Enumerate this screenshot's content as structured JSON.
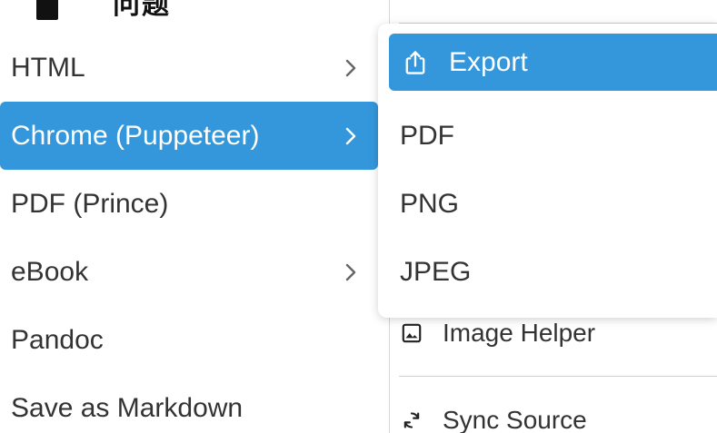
{
  "header": {
    "title_partial": "问题"
  },
  "export_menu": {
    "items": [
      {
        "label": "HTML",
        "has_submenu": true,
        "active": false
      },
      {
        "label": "Chrome (Puppeteer)",
        "has_submenu": true,
        "active": true
      },
      {
        "label": "PDF (Prince)",
        "has_submenu": false,
        "active": false
      },
      {
        "label": "eBook",
        "has_submenu": true,
        "active": false
      },
      {
        "label": "Pandoc",
        "has_submenu": false,
        "active": false
      },
      {
        "label": "Save as Markdown",
        "has_submenu": false,
        "active": false
      }
    ]
  },
  "submenu": {
    "header_label": "Export",
    "header_icon": "share-icon",
    "items": [
      {
        "label": "PDF"
      },
      {
        "label": "PNG"
      },
      {
        "label": "JPEG"
      }
    ]
  },
  "background_menu": {
    "items": [
      {
        "label": "Image Helper",
        "icon": "image-icon"
      },
      {
        "label": "Sync Source",
        "icon": "sync-icon"
      }
    ]
  },
  "colors": {
    "accent": "#3597db",
    "text": "#333333",
    "divider": "#cfcfcf"
  }
}
